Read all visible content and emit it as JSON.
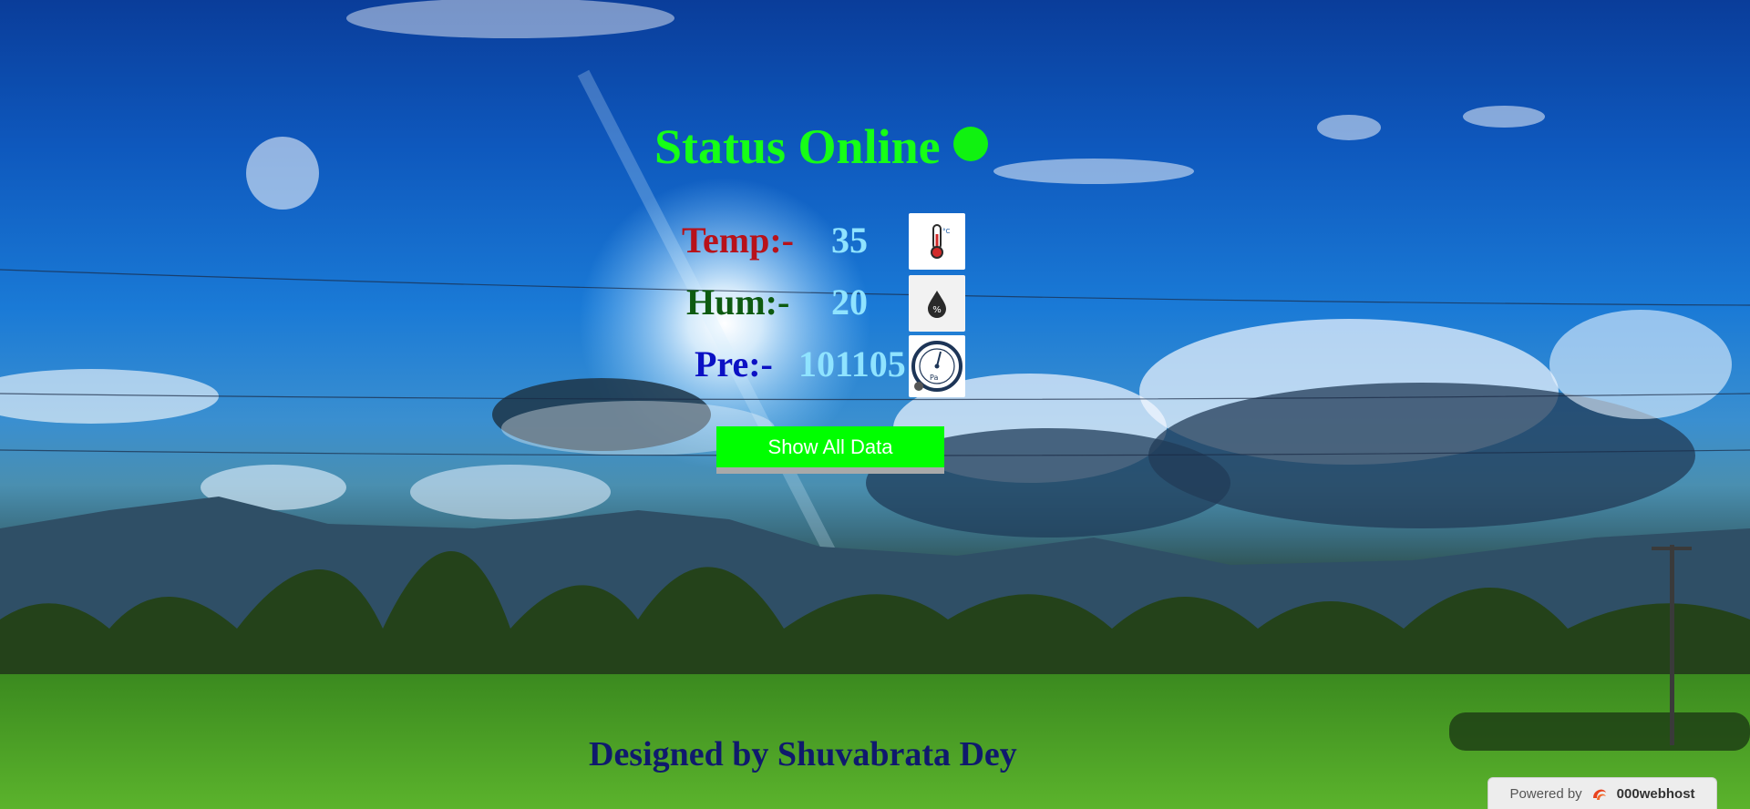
{
  "status": {
    "text": "Status Online",
    "color": "#16ff16"
  },
  "readings": [
    {
      "label": "Temp:-",
      "value": "35",
      "icon": "thermometer-icon",
      "icon_text": "°C"
    },
    {
      "label": "Hum:-",
      "value": "20",
      "icon": "humidity-drop-icon",
      "icon_text": "%"
    },
    {
      "label": "Pre:-",
      "value": "101105",
      "icon": "pressure-gauge-icon",
      "icon_text": "Pa"
    }
  ],
  "button": {
    "label": "Show All Data",
    "color": "#00ff00"
  },
  "footer": {
    "credit": "Designed by Shuvabrata Dey"
  },
  "host_badge": {
    "prefix": "Powered by",
    "brand": "000webhost"
  }
}
